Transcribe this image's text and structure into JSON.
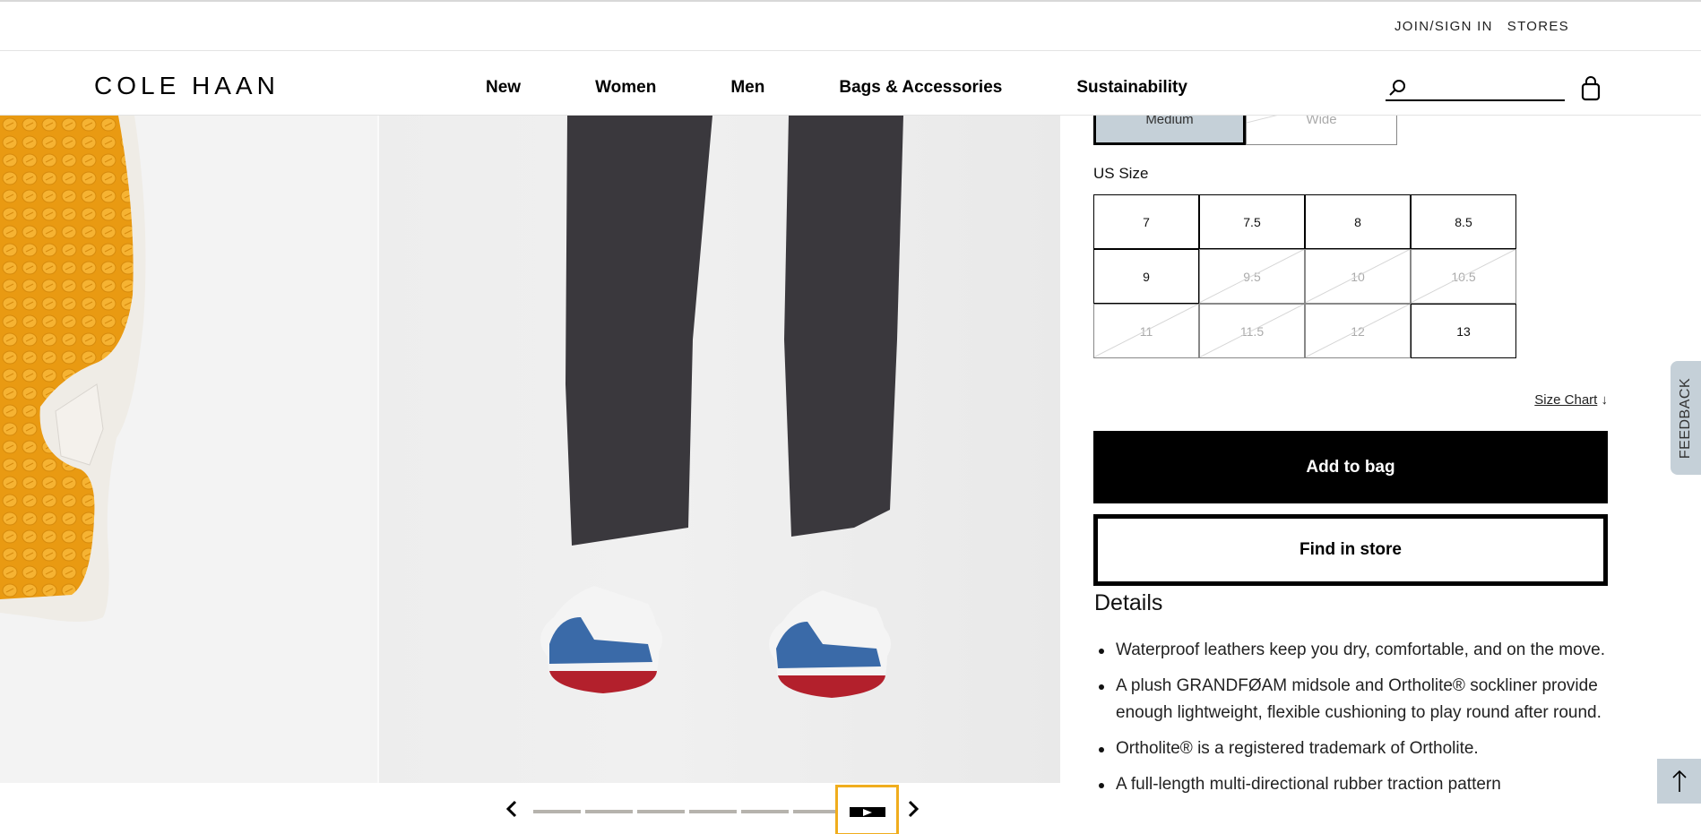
{
  "utility_bar": {
    "join_sign_in": "JOIN/SIGN IN",
    "stores": "STORES"
  },
  "header": {
    "logo": "COLE HAAN",
    "nav": [
      "New",
      "Women",
      "Men",
      "Bags & Accessories",
      "Sustainability"
    ],
    "search_value": "",
    "search_placeholder": ""
  },
  "gallery": {
    "images": [
      {
        "subject": "orange outsole close-up",
        "sole_color": "#f2a51e"
      },
      {
        "subject": "model wearing blue and white golf sneakers (video)",
        "shoe_accent": "#3a6aa8"
      }
    ],
    "carousel": {
      "prev_icon": "chevron-left-icon",
      "next_icon": "chevron-right-icon",
      "thumbnail_count": 7,
      "active_index": 6,
      "active_type": "video",
      "active_color": "#f0ad1d"
    }
  },
  "product": {
    "width_options": [
      {
        "label": "Medium",
        "selected": true,
        "available": true
      },
      {
        "label": "Wide",
        "selected": false,
        "available": false
      }
    ],
    "size_label": "US Size",
    "sizes": [
      {
        "label": "7",
        "available": true
      },
      {
        "label": "7.5",
        "available": true
      },
      {
        "label": "8",
        "available": true
      },
      {
        "label": "8.5",
        "available": true
      },
      {
        "label": "9",
        "available": true
      },
      {
        "label": "9.5",
        "available": false
      },
      {
        "label": "10",
        "available": false
      },
      {
        "label": "10.5",
        "available": false
      },
      {
        "label": "11",
        "available": false
      },
      {
        "label": "11.5",
        "available": false
      },
      {
        "label": "12",
        "available": false
      },
      {
        "label": "13",
        "available": true
      }
    ],
    "size_chart_label": "Size Chart",
    "size_chart_arrow": "↓",
    "add_to_bag": "Add to bag",
    "find_in_store": "Find in store",
    "details_title": "Details",
    "details": [
      "Waterproof leathers keep you dry, comfortable, and on the move.",
      "A plush GRANDFØAM midsole and Ortholite® sockliner provide enough lightweight, flexible cushioning to play round after round.",
      "Ortholite® is a registered trademark of Ortholite.",
      "A full-length multi-directional rubber traction pattern"
    ]
  },
  "floating": {
    "feedback": "FEEDBACK",
    "back_to_top_icon": "arrow-up-icon"
  },
  "colors": {
    "selected_bg": "#c5d0d8",
    "accent_orange": "#f0ad1d",
    "primary": "#000000"
  }
}
